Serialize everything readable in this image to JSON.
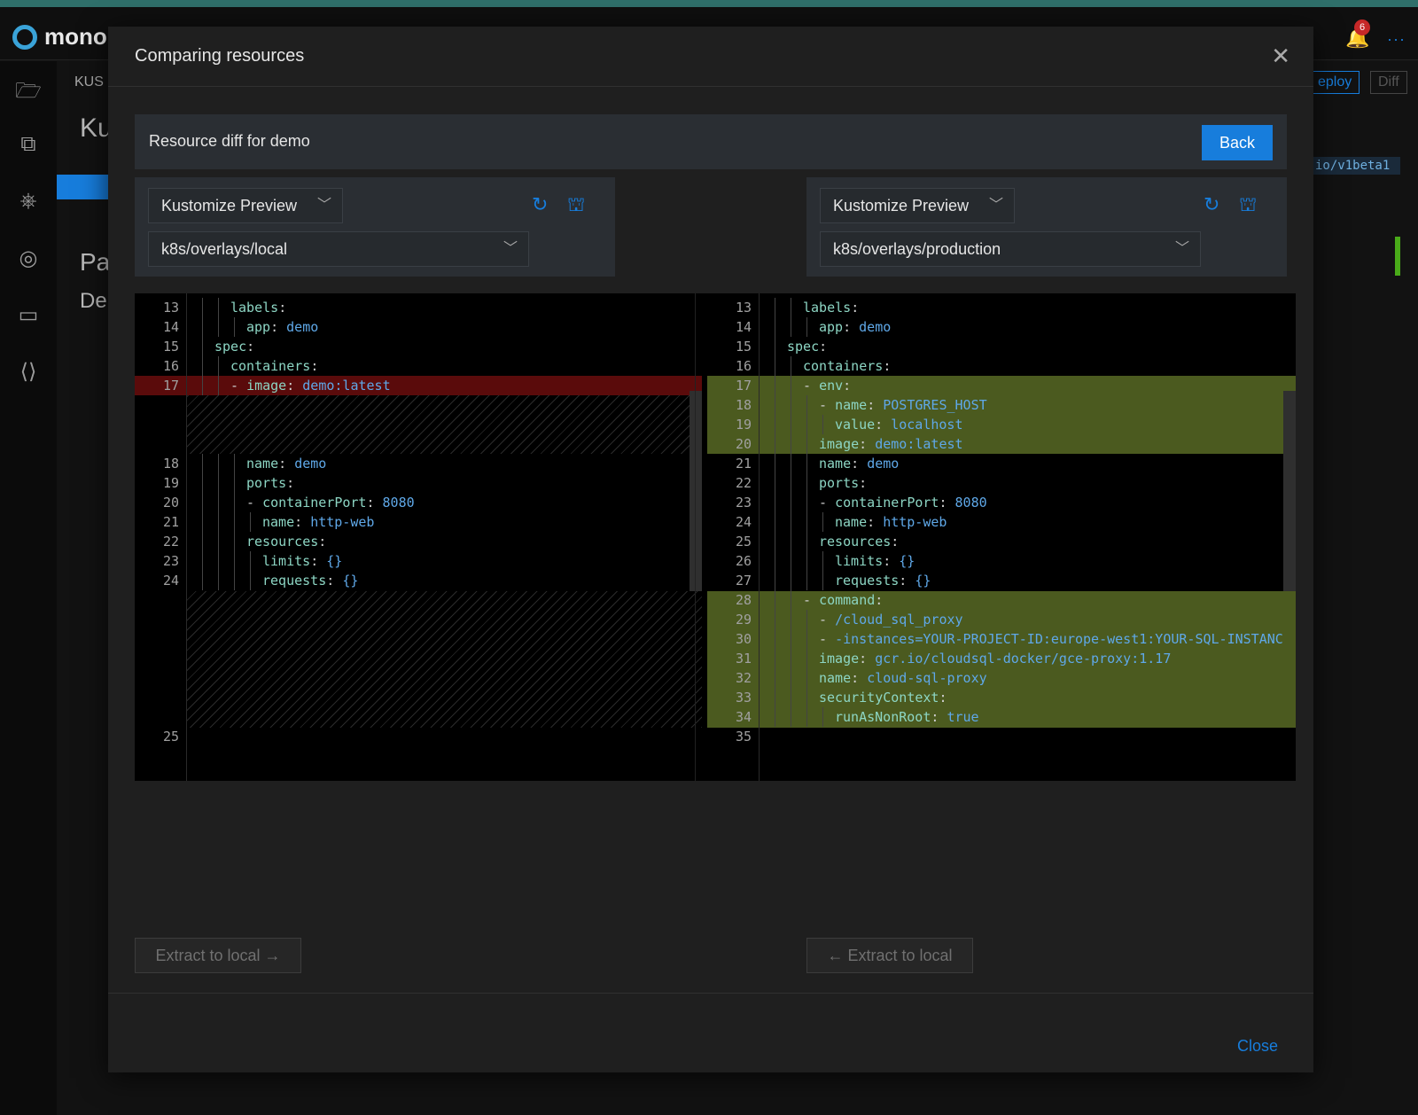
{
  "app": {
    "logo_text": "mono",
    "notification_count": "6",
    "bg_kus": "KUS",
    "bg_ku": "Ku",
    "bg_pa": "Pa",
    "bg_de": "De",
    "bg_deploy": "eploy",
    "bg_diff": "Diff",
    "bg_code": "io/v1beta1"
  },
  "modal": {
    "title": "Comparing resources",
    "diff_title": "Resource diff for demo",
    "back_label": "Back",
    "close_label": "Close",
    "left": {
      "preview_label": "Kustomize Preview",
      "path": "k8s/overlays/local",
      "extract_label": "Extract to local"
    },
    "right": {
      "preview_label": "Kustomize Preview",
      "path": "k8s/overlays/production",
      "extract_label": "Extract to local"
    }
  },
  "diff": {
    "left_lines": [
      {
        "n": "13",
        "indent": 2,
        "k": "labels",
        "v": ""
      },
      {
        "n": "14",
        "indent": 3,
        "k": "app",
        "v": "demo"
      },
      {
        "n": "15",
        "indent": 1,
        "k": "spec",
        "v": ""
      },
      {
        "n": "16",
        "indent": 2,
        "k": "containers",
        "v": ""
      },
      {
        "n": "17",
        "indent": 2,
        "dash": true,
        "k": "image",
        "v": "demo:latest"
      },
      {
        "n": "18",
        "indent": 3,
        "k": "name",
        "v": "demo"
      },
      {
        "n": "19",
        "indent": 3,
        "k": "ports",
        "v": ""
      },
      {
        "n": "20",
        "indent": 3,
        "dash": true,
        "k": "containerPort",
        "v": "8080"
      },
      {
        "n": "21",
        "indent": 4,
        "k": "name",
        "v": "http-web"
      },
      {
        "n": "22",
        "indent": 3,
        "k": "resources",
        "v": ""
      },
      {
        "n": "23",
        "indent": 4,
        "k": "limits",
        "v": "{}"
      },
      {
        "n": "24",
        "indent": 4,
        "k": "requests",
        "v": "{}"
      },
      {
        "n": "25",
        "indent": 0,
        "k": "",
        "v": ""
      }
    ],
    "right_lines": [
      {
        "n": "13",
        "indent": 2,
        "k": "labels",
        "v": ""
      },
      {
        "n": "14",
        "indent": 3,
        "k": "app",
        "v": "demo"
      },
      {
        "n": "15",
        "indent": 1,
        "k": "spec",
        "v": ""
      },
      {
        "n": "16",
        "indent": 2,
        "k": "containers",
        "v": ""
      },
      {
        "n": "17",
        "indent": 2,
        "dash": true,
        "k": "env",
        "v": ""
      },
      {
        "n": "18",
        "indent": 3,
        "dash": true,
        "k": "name",
        "v": "POSTGRES_HOST"
      },
      {
        "n": "19",
        "indent": 4,
        "k": "value",
        "v": "localhost"
      },
      {
        "n": "20",
        "indent": 3,
        "k": "image",
        "v": "demo:latest"
      },
      {
        "n": "21",
        "indent": 3,
        "k": "name",
        "v": "demo"
      },
      {
        "n": "22",
        "indent": 3,
        "k": "ports",
        "v": ""
      },
      {
        "n": "23",
        "indent": 3,
        "dash": true,
        "k": "containerPort",
        "v": "8080"
      },
      {
        "n": "24",
        "indent": 4,
        "k": "name",
        "v": "http-web"
      },
      {
        "n": "25",
        "indent": 3,
        "k": "resources",
        "v": ""
      },
      {
        "n": "26",
        "indent": 4,
        "k": "limits",
        "v": "{}"
      },
      {
        "n": "27",
        "indent": 4,
        "k": "requests",
        "v": "{}"
      },
      {
        "n": "28",
        "indent": 2,
        "dash": true,
        "k": "command",
        "v": ""
      },
      {
        "n": "29",
        "indent": 3,
        "dash": true,
        "k": "",
        "v": "/cloud_sql_proxy"
      },
      {
        "n": "30",
        "indent": 3,
        "dash": true,
        "k": "",
        "v": "-instances=YOUR-PROJECT-ID:europe-west1:YOUR-SQL-INSTANC"
      },
      {
        "n": "31",
        "indent": 3,
        "k": "image",
        "v": "gcr.io/cloudsql-docker/gce-proxy:1.17"
      },
      {
        "n": "32",
        "indent": 3,
        "k": "name",
        "v": "cloud-sql-proxy"
      },
      {
        "n": "33",
        "indent": 3,
        "k": "securityContext",
        "v": ""
      },
      {
        "n": "34",
        "indent": 4,
        "k": "runAsNonRoot",
        "v": "true"
      },
      {
        "n": "35",
        "indent": 0,
        "k": "",
        "v": ""
      }
    ]
  }
}
